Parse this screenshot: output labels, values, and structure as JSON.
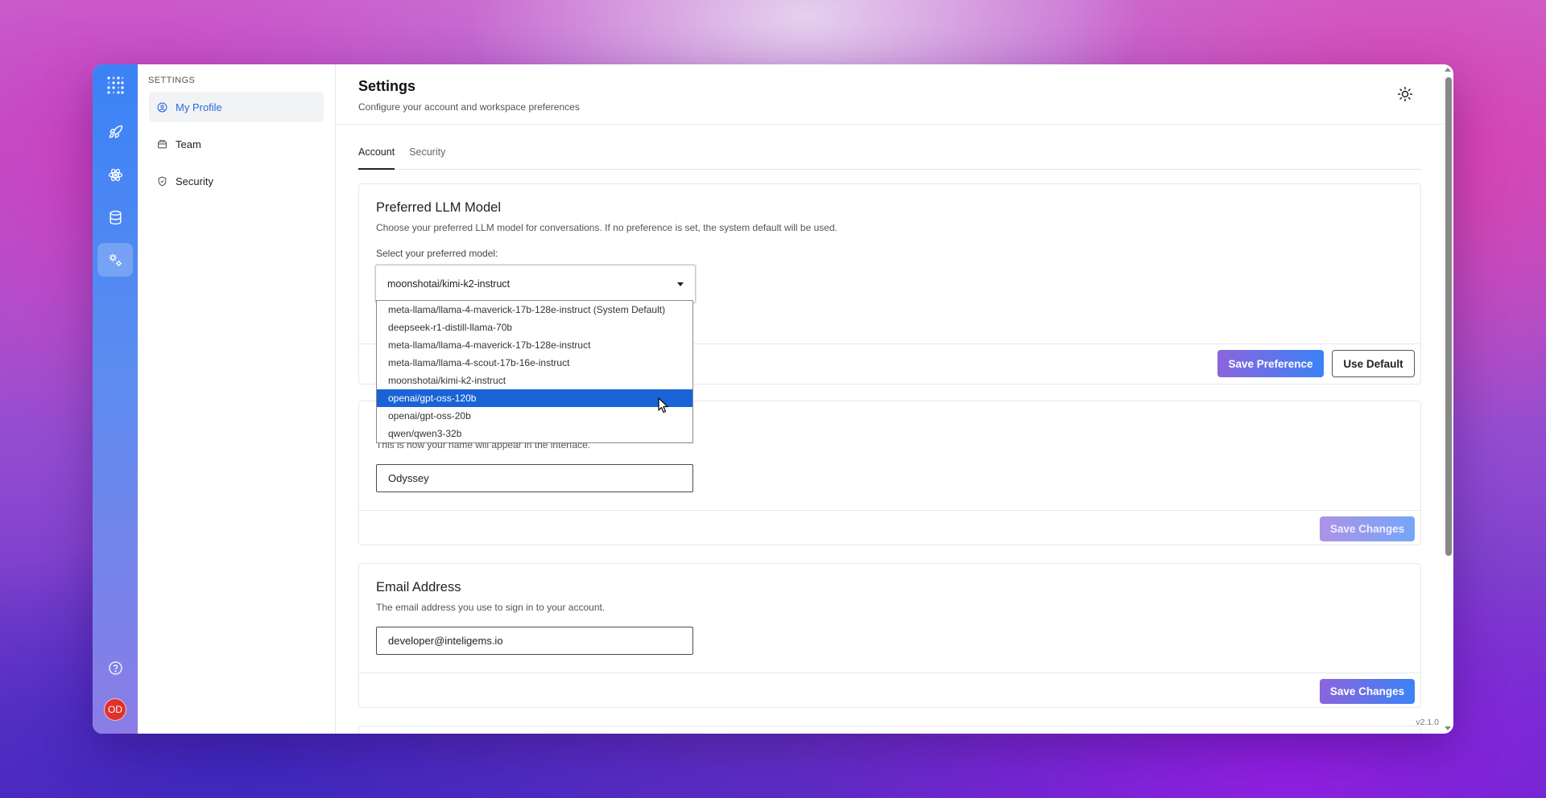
{
  "rail": {
    "items": [
      {
        "icon": "rocket-icon"
      },
      {
        "icon": "atom-icon"
      },
      {
        "icon": "database-icon"
      },
      {
        "icon": "gears-icon"
      }
    ],
    "help_icon": "help-circle-icon",
    "avatar_initials": "OD",
    "avatar_color": "#e0312d"
  },
  "subnav": {
    "heading": "SETTINGS",
    "items": [
      {
        "label": "My Profile",
        "icon": "user-circle-icon",
        "active": true
      },
      {
        "label": "Team",
        "icon": "team-icon",
        "active": false
      },
      {
        "label": "Security",
        "icon": "shield-icon",
        "active": false
      }
    ]
  },
  "header": {
    "title": "Settings",
    "subtitle": "Configure your account and workspace preferences"
  },
  "tabs": [
    {
      "label": "Account",
      "active": true
    },
    {
      "label": "Security",
      "active": false
    }
  ],
  "llm_card": {
    "title": "Preferred LLM Model",
    "description": "Choose your preferred LLM model for conversations. If no preference is set, the system default will be used.",
    "select_label": "Select your preferred model:",
    "selected_value": "moonshotai/kimi-k2-instruct",
    "options": [
      "meta-llama/llama-4-maverick-17b-128e-instruct (System Default)",
      "deepseek-r1-distill-llama-70b",
      "meta-llama/llama-4-maverick-17b-128e-instruct",
      "meta-llama/llama-4-scout-17b-16e-instruct",
      "moonshotai/kimi-k2-instruct",
      "openai/gpt-oss-120b",
      "openai/gpt-oss-20b",
      "qwen/qwen3-32b"
    ],
    "highlighted_option": "openai/gpt-oss-120b",
    "save_label": "Save Preference",
    "default_label": "Use Default"
  },
  "name_card": {
    "description": "This is how your name will appear in the interface.",
    "value": "Odyssey",
    "save_label": "Save Changes"
  },
  "email_card": {
    "title": "Email Address",
    "description": "The email address you use to sign in to your account.",
    "value": "developer@inteligems.io",
    "save_label": "Save Changes"
  },
  "version": "v2.1.0",
  "colors": {
    "accent": "#2d6bd6",
    "button_gradient_start": "#8b65dc",
    "button_gradient_end": "#3b82f6",
    "selection": "#1a63d6"
  }
}
